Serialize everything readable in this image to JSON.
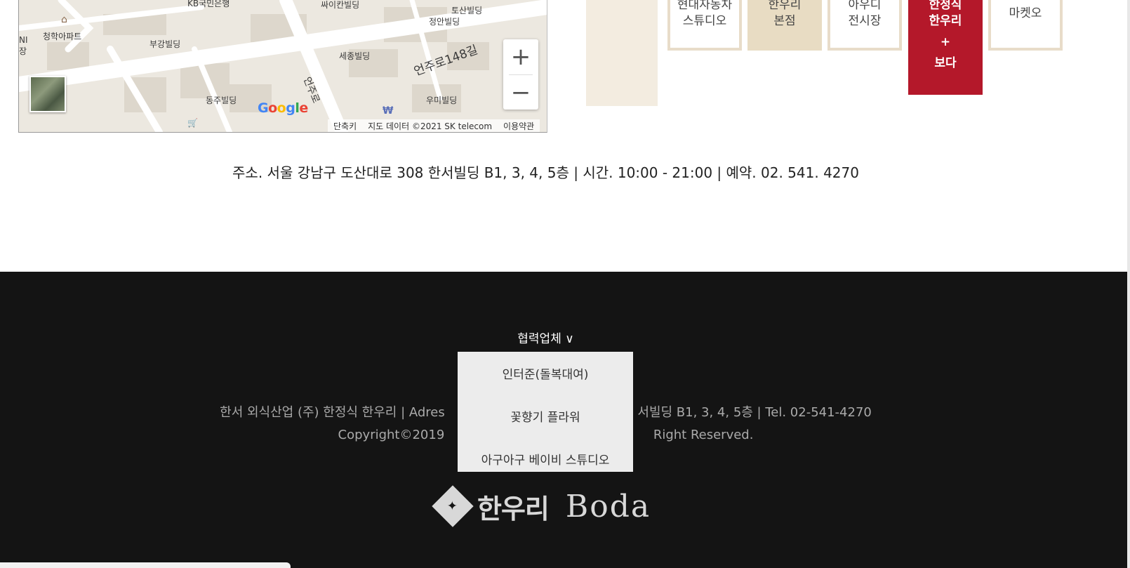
{
  "map": {
    "labels": [
      {
        "id": "kb",
        "text": "KB국민은행"
      },
      {
        "id": "ssaikan",
        "text": "싸이칸빌딩"
      },
      {
        "id": "tosan",
        "text": "토산빌딩"
      },
      {
        "id": "jeongan",
        "text": "정안빌딩"
      },
      {
        "id": "cheonghak",
        "text": "청학아파트"
      },
      {
        "id": "bugang",
        "text": "부강빌딩"
      },
      {
        "id": "sejong",
        "text": "세종빌딩"
      },
      {
        "id": "road",
        "text": "언주로148길"
      },
      {
        "id": "eonjuro",
        "text": "언주로"
      },
      {
        "id": "dongju",
        "text": "동주빌딩"
      },
      {
        "id": "umi",
        "text": "우미빌딩"
      },
      {
        "id": "ni",
        "text": "NI"
      },
      {
        "id": "jang",
        "text": "장"
      }
    ],
    "zoom_in": "+",
    "zoom_out": "−",
    "google_logo": "Google",
    "attribution": {
      "shortcuts": "단축키",
      "data": "지도 데이터 ©2021 SK telecom",
      "terms": "이용약관"
    }
  },
  "tabs": [
    {
      "label_line1": "현대자동차",
      "label_line2": "스튜디오",
      "style": "outline"
    },
    {
      "label_line1": "한우리",
      "label_line2": "본점",
      "style": "fill"
    },
    {
      "label_line1": "아우디",
      "label_line2": "전시장",
      "style": "outline"
    },
    {
      "label_line1": "한정식",
      "label_line2": "한우리",
      "label_line3": "+",
      "label_line4": "보다",
      "style": "active"
    },
    {
      "label_line1": "마켓오",
      "style": "outline"
    }
  ],
  "address_line": "주소. 서울 강남구 도산대로 308 한서빌딩 B1, 3, 4, 5층 | 시간. 10:00 - 21:00 | 예약. 02. 541. 4270",
  "footer": {
    "partners_label": "협력업체 ∨",
    "dropdown": [
      "인터준(돌복대여)",
      "꽃향기 플라워",
      "아구아구 베이비 스튜디오"
    ],
    "company_line": "한서 외식산업 (주) 한정식 한우리 | Adres                                                서빌딩 B1, 3, 4, 5층 | Tel. 02-541-4270",
    "copyright_line": "Copyright©2019                                                    Right Reserved.",
    "logo_kr": "한우리",
    "logo_en": "Boda"
  },
  "colors": {
    "accent": "#b4182a",
    "beige": "#e8dcc3",
    "footer_bg": "#141414"
  }
}
